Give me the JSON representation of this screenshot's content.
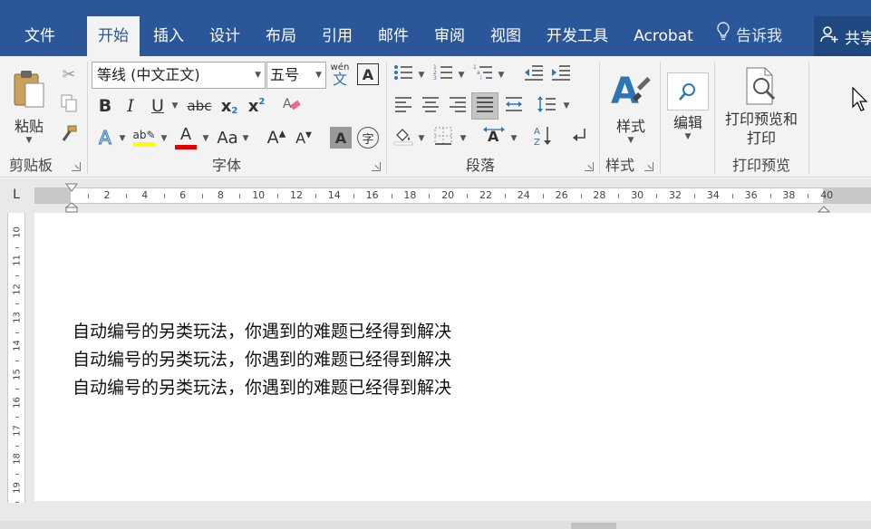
{
  "tabs": [
    {
      "label": "文件"
    },
    {
      "label": "开始"
    },
    {
      "label": "插入"
    },
    {
      "label": "设计"
    },
    {
      "label": "布局"
    },
    {
      "label": "引用"
    },
    {
      "label": "邮件"
    },
    {
      "label": "审阅"
    },
    {
      "label": "视图"
    },
    {
      "label": "开发工具"
    },
    {
      "label": "Acrobat"
    }
  ],
  "tell_me": "告诉我",
  "share": "共享",
  "clipboard": {
    "paste": "粘贴",
    "group": "剪贴板"
  },
  "font": {
    "name": "等线 (中文正文)",
    "size": "五号",
    "pinyin": "wén",
    "pinyin_char": "文",
    "bold": "B",
    "italic": "I",
    "underline": "U",
    "strike": "abc",
    "subscript": "x",
    "subscript_mark": "2",
    "superscript": "x",
    "superscript_mark": "2",
    "change_case": "Aa",
    "group": "字体"
  },
  "paragraph": {
    "group": "段落"
  },
  "styles": {
    "label": "样式",
    "group": "样式"
  },
  "editing": {
    "label": "编辑"
  },
  "print_preview": {
    "label_line1": "打印预览和",
    "label_line2": "打印",
    "group": "打印预览"
  },
  "ruler": {
    "labels": [
      "2",
      "4",
      "6",
      "8",
      "10",
      "12",
      "14",
      "16",
      "18",
      "20",
      "22",
      "24",
      "26",
      "28",
      "30",
      "32",
      "34",
      "36",
      "38",
      "40"
    ],
    "vertical_labels": [
      "10",
      "11",
      "12",
      "13",
      "14",
      "15",
      "16",
      "17",
      "18",
      "19"
    ]
  },
  "document": {
    "lines": [
      "自动编号的另类玩法，你遇到的难题已经得到解决",
      "自动编号的另类玩法，你遇到的难题已经得到解决",
      "自动编号的另类玩法，你遇到的难题已经得到解决"
    ]
  },
  "colors": {
    "tabbar": "#2b579a",
    "ribbon": "#f3f3f3",
    "highlight": "#ffff00",
    "font_color": "#e00000",
    "accent_blue": "#2e75b6"
  }
}
